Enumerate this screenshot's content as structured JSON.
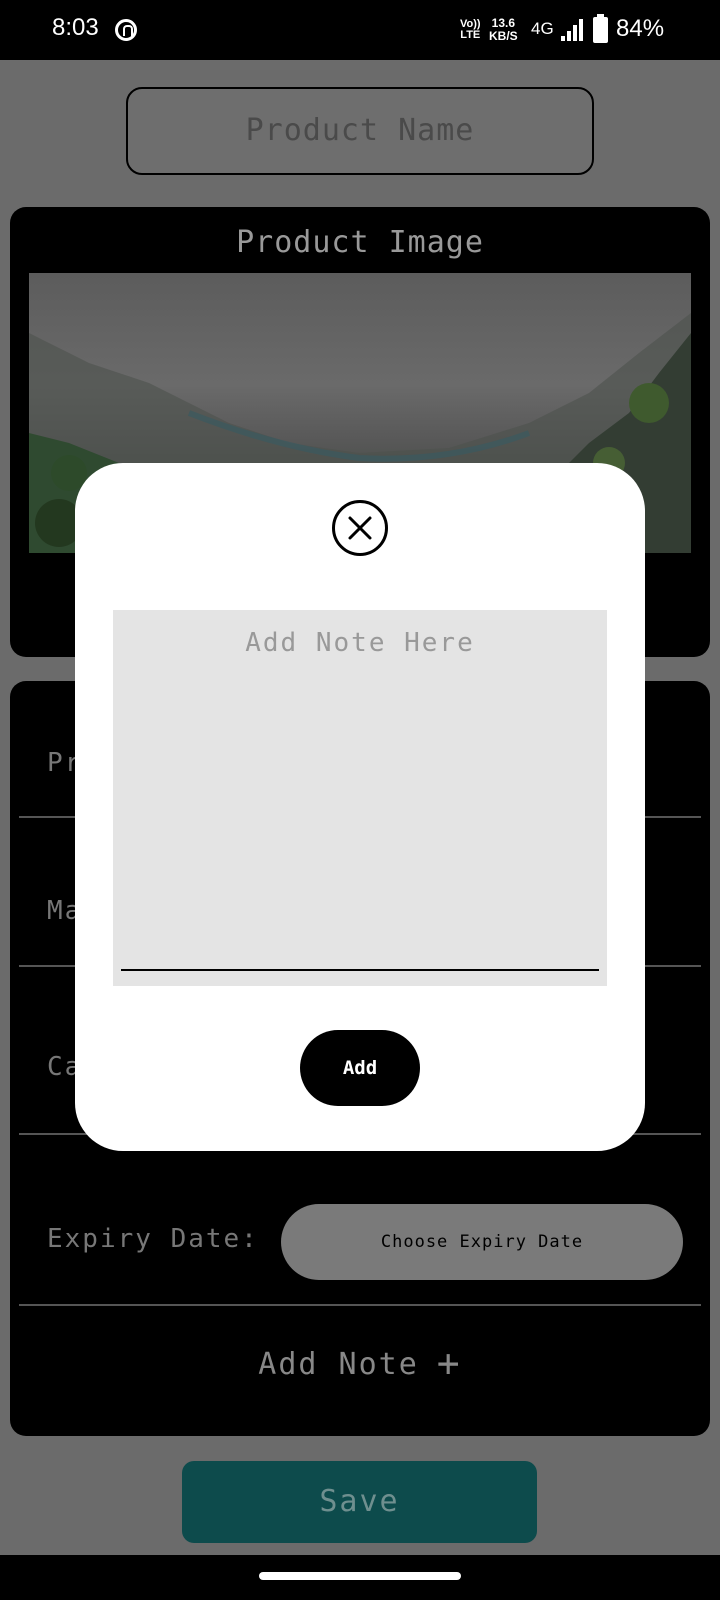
{
  "status_bar": {
    "time": "8:03",
    "volte_line1": "Vo))",
    "volte_line2": "LTE",
    "speed_value": "13.6",
    "speed_unit": "KB/S",
    "network": "4G",
    "battery_percent": "84%",
    "battery_level": 0.84
  },
  "form": {
    "product_name_placeholder": "Product Name",
    "image_card_title": "Product Image",
    "rows": {
      "row1_label": "Pr",
      "row2_label": "Ma",
      "row3_label": "Ca",
      "expiry_label": "Expiry Date:"
    },
    "expiry_button": "Choose Expiry Date",
    "add_note_label": "Add Note",
    "add_note_icon": "+",
    "save_button": "Save"
  },
  "dialog": {
    "note_placeholder": "Add Note Here",
    "add_button": "Add",
    "close_icon": "close-icon"
  },
  "colors": {
    "scrim_background": "#6b6b6b",
    "card_background": "#000000",
    "save_button": "#0d4b4c",
    "dialog_background": "#ffffff",
    "note_area": "#e4e4e4"
  }
}
